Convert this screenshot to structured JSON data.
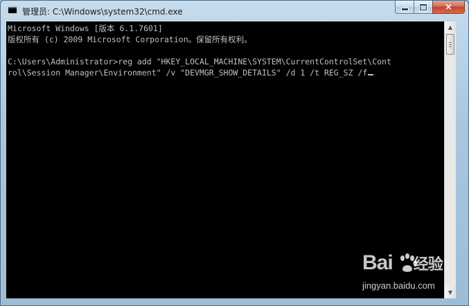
{
  "window": {
    "title": "管理员: C:\\Windows\\system32\\cmd.exe",
    "app_icon": "cmd-icon"
  },
  "caption_buttons": {
    "minimize": "minimize-icon",
    "maximize": "maximize-icon",
    "close_glyph": "×"
  },
  "console": {
    "lines": [
      "Microsoft Windows [版本 6.1.7601]",
      "版权所有 (c) 2009 Microsoft Corporation。保留所有权利。",
      "",
      "C:\\Users\\Administrator>reg add \"HKEY_LOCAL_MACHINE\\SYSTEM\\CurrentControlSet\\Cont",
      "rol\\Session Manager\\Environment\" /v \"DEVMGR_SHOW_DETAILS\" /d 1 /t REG_SZ /f"
    ],
    "text_color": "#c0c0c0",
    "background": "#000000"
  },
  "scrollbar": {
    "up_glyph": "▲",
    "down_glyph": "▼"
  },
  "watermark": {
    "logo_left": "Bai",
    "logo_right": "经验",
    "url": "jingyan.baidu.com"
  }
}
